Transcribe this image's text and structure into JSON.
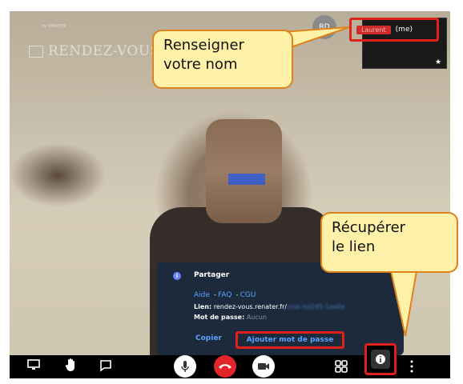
{
  "brand": {
    "name": "RENDEZ-VOUS",
    "sub": "by RENATER"
  },
  "participant": {
    "avatar_initials": "RD",
    "name": "Laurent",
    "me_label": "(me)"
  },
  "callouts": {
    "name": "Renseigner\nvotre nom",
    "link": "Récupérer\nle lien"
  },
  "share_panel": {
    "title": "Partager",
    "aide": "Aide",
    "faq": "FAQ",
    "cgu": "CGU",
    "link_label": "Lien:",
    "link_value": "rendez-vous.renater.fr/",
    "link_hidden": "icub-hd245-1ae6x",
    "password_label": "Mot de passe:",
    "password_value": "Aucun",
    "copy_label": "Copier",
    "add_password_label": "Ajouter mot de passe"
  },
  "colors": {
    "accent_red": "#e0201b",
    "link_blue": "#5aa0ff",
    "callout_fill": "#fff2a8",
    "callout_border": "#e0821b",
    "hangup_red": "#e3242b"
  },
  "toolbar": {
    "icons": [
      "screen-share-icon",
      "raise-hand-icon",
      "chat-icon",
      "microphone-icon",
      "hang-up-icon",
      "camera-icon",
      "tile-view-icon",
      "info-icon",
      "more-icon"
    ]
  }
}
